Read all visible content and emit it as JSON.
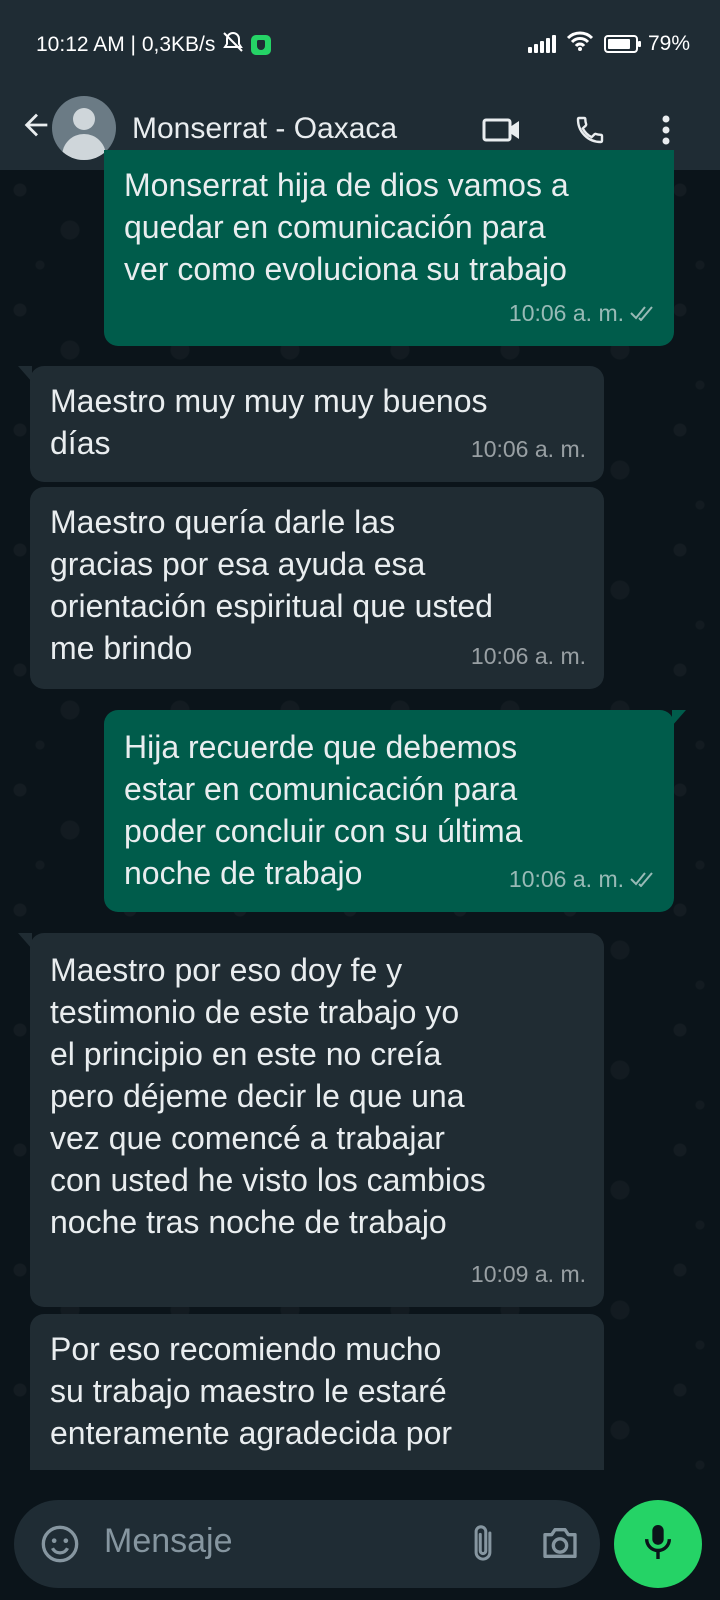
{
  "status_bar": {
    "time_speed": "10:12 AM | 0,3KB/s",
    "battery": "79%"
  },
  "header": {
    "contact_name": "Monserrat - Oaxaca"
  },
  "messages": [
    {
      "direction": "outgoing",
      "lines": [
        "Monserrat hija de dios vamos a",
        "quedar en comunicación para",
        "ver como evoluciona su trabajo"
      ],
      "time": "10:06 a. m.",
      "read": true
    },
    {
      "direction": "incoming",
      "lines": [
        "Maestro muy muy muy buenos",
        "días"
      ],
      "time": "10:06 a. m."
    },
    {
      "direction": "incoming",
      "lines": [
        "Maestro quería darle las",
        "gracias por esa ayuda esa",
        "orientación espiritual que usted",
        "me brindo"
      ],
      "time": "10:06 a. m."
    },
    {
      "direction": "outgoing",
      "lines": [
        "Hija recuerde que debemos",
        "estar en comunicación para",
        "poder concluir con su última",
        "noche de trabajo"
      ],
      "time": "10:06 a. m.",
      "read": true
    },
    {
      "direction": "incoming",
      "lines": [
        "Maestro por eso doy fe y",
        "testimonio de este trabajo yo",
        "el principio en este no creía",
        "pero déjeme decir le que una",
        "vez que comencé a trabajar",
        "con usted he visto los cambios",
        "noche tras noche de trabajo"
      ],
      "time": "10:09 a. m."
    },
    {
      "direction": "incoming",
      "lines": [
        "Por eso recomiendo mucho",
        "su trabajo maestro le estaré",
        "enteramente agradecida por"
      ],
      "time": ""
    }
  ],
  "input": {
    "placeholder": "Mensaje"
  },
  "colors": {
    "outgoing_bubble": "#005c4b",
    "incoming_bubble": "#202c33",
    "accent": "#25d366",
    "background": "#0b141a"
  }
}
